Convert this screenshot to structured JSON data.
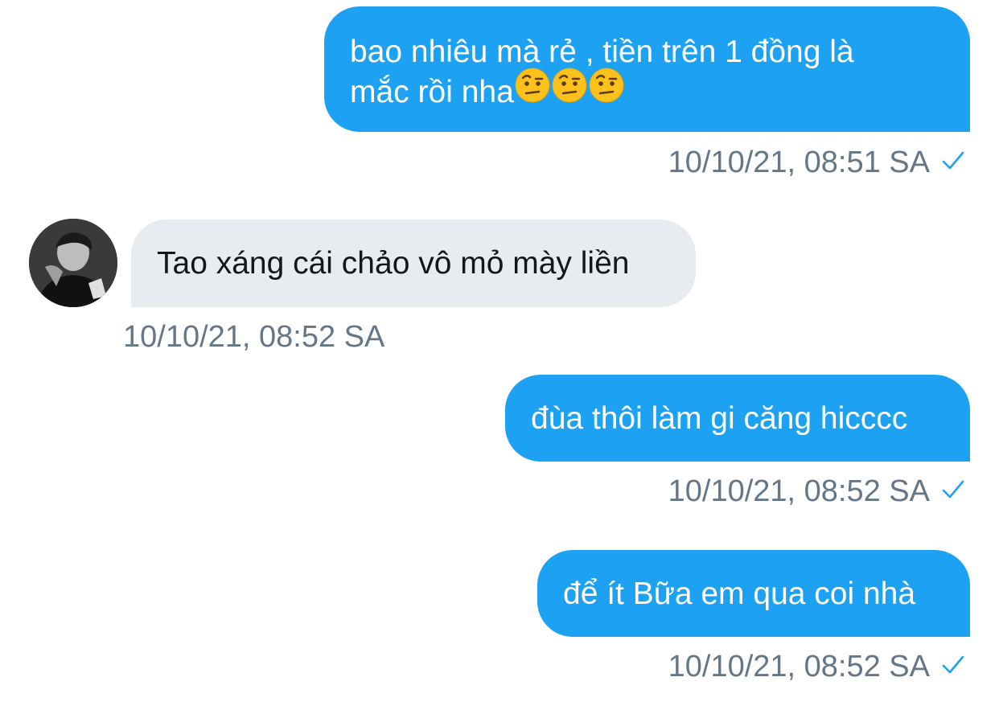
{
  "messages": [
    {
      "direction": "sent",
      "line1": "bao nhiêu mà rẻ , tiền trên 1 đồng là",
      "line2": "mắc rồi nha",
      "emojis": [
        "raised-eyebrow-emoji",
        "raised-eyebrow-emoji",
        "raised-eyebrow-emoji"
      ],
      "timestamp": "10/10/21, 08:51 SA",
      "status_icon": "check-icon"
    },
    {
      "direction": "received",
      "text": "Tao xáng cái chảo vô mỏ mày liền",
      "timestamp": "10/10/21, 08:52 SA",
      "avatar": "user-avatar"
    },
    {
      "direction": "sent",
      "text": "đùa thôi làm gi căng hicccc",
      "timestamp": "10/10/21, 08:52 SA",
      "status_icon": "check-icon"
    },
    {
      "direction": "sent",
      "text": "để ít Bữa em qua coi nhà",
      "timestamp": "10/10/21, 08:52 SA",
      "status_icon": "check-icon"
    }
  ],
  "colors": {
    "sent_bubble": "#1da1f2",
    "received_bubble": "#e6ecf0",
    "timestamp": "#657786",
    "check": "#1da1f2"
  }
}
